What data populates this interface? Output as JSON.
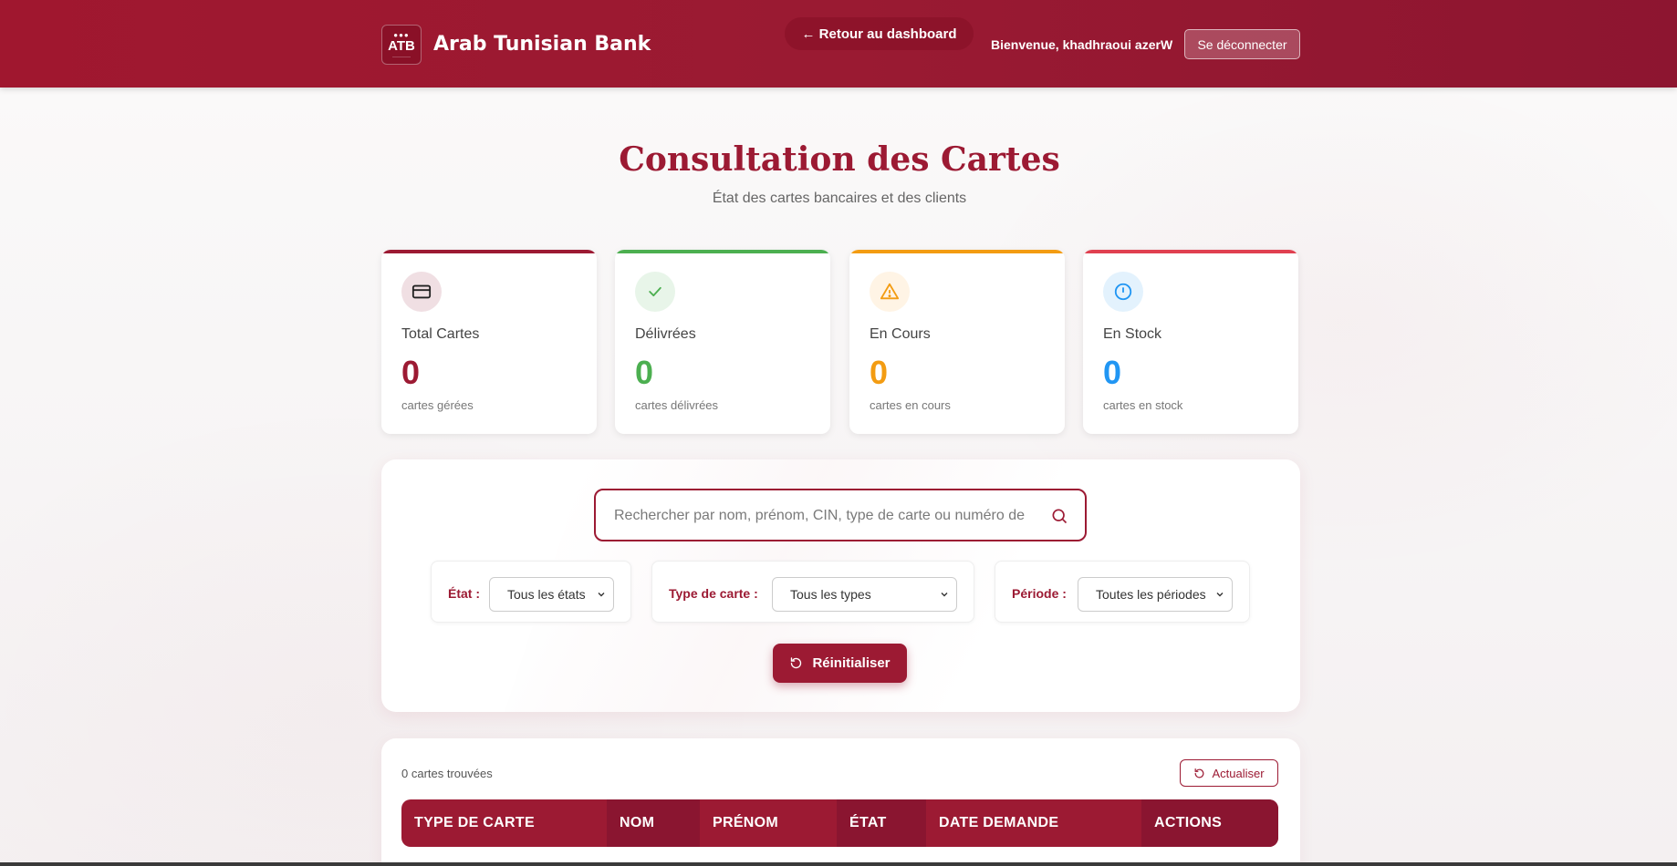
{
  "header": {
    "logo_abbr": "ATB",
    "brand": "Arab Tunisian Bank",
    "back_label": "← Retour au dashboard",
    "welcome": "Bienvenue, khadhraoui azerW",
    "logout_label": "Se déconnecter",
    "color": "#9c1a33"
  },
  "page": {
    "title": "Consultation des Cartes",
    "subtitle": "État des cartes bancaires et des clients"
  },
  "stats": [
    {
      "label": "Total Cartes",
      "value": "0",
      "caption": "cartes gérées",
      "color": "#9c1a33",
      "icon": "credit-card-icon"
    },
    {
      "label": "Délivrées",
      "value": "0",
      "caption": "cartes délivrées",
      "color": "#4caf50",
      "icon": "check-icon"
    },
    {
      "label": "En Cours",
      "value": "0",
      "caption": "cartes en cours",
      "color": "#f39c12",
      "icon": "warning-icon"
    },
    {
      "label": "En Stock",
      "value": "0",
      "caption": "cartes en stock",
      "color": "#2196f3",
      "icon": "info-icon"
    }
  ],
  "search": {
    "placeholder": "Rechercher par nom, prénom, CIN, type de carte ou numéro de c",
    "value": ""
  },
  "filters": {
    "etat": {
      "label": "État :",
      "selected": "Tous les états"
    },
    "type": {
      "label": "Type de carte :",
      "selected": "Tous les types"
    },
    "periode": {
      "label": "Période :",
      "selected": "Toutes les périodes"
    }
  },
  "reset_label": "Réinitialiser",
  "results": {
    "count_text": "0 cartes trouvées",
    "refresh_label": "Actualiser",
    "columns": [
      "TYPE DE CARTE",
      "NOM",
      "PRÉNOM",
      "ÉTAT",
      "DATE DEMANDE",
      "ACTIONS"
    ]
  }
}
